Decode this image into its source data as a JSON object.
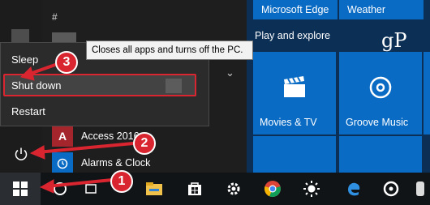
{
  "start_menu": {
    "section_hash": "#",
    "apps": [
      {
        "label": "Access 2016"
      },
      {
        "label": "Alarms & Clock"
      }
    ]
  },
  "power_menu": {
    "items": [
      {
        "label": "Sleep"
      },
      {
        "label": "Shut down"
      },
      {
        "label": "Restart"
      }
    ],
    "tooltip": "Closes all apps and turns off the PC."
  },
  "tiles": {
    "top_row": [
      {
        "label": "Microsoft Edge"
      },
      {
        "label": "Weather"
      }
    ],
    "group_label": "Play and explore",
    "watermark": "gP",
    "items": [
      {
        "label": "Movies & TV",
        "icon": "clapperboard-icon"
      },
      {
        "label": "Groove Music",
        "icon": "music-disc-icon"
      }
    ]
  },
  "callouts": {
    "one": "1",
    "two": "2",
    "three": "3"
  },
  "colors": {
    "accent": "#0a6bc4",
    "highlight": "#d9252f",
    "tile_bg": "#0b2f55"
  },
  "taskbar": {
    "icons": [
      "windows-start-icon",
      "cortana-icon",
      "task-view-icon",
      "file-explorer-icon",
      "store-icon",
      "settings-icon",
      "chrome-icon",
      "brightness-icon",
      "edge-icon",
      "groove-icon"
    ]
  }
}
